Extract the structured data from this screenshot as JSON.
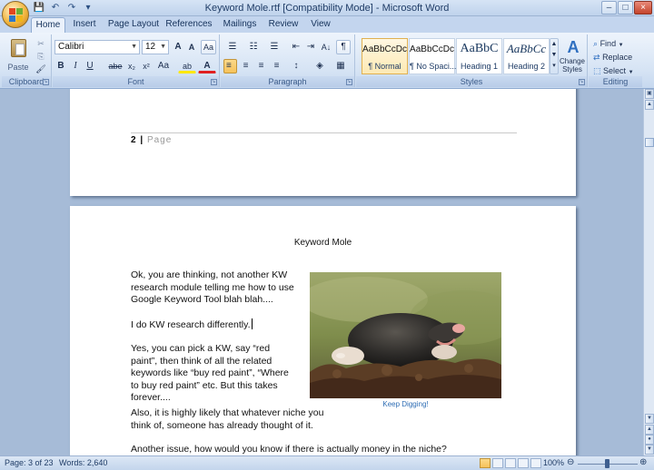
{
  "window": {
    "title": "Keyword Mole.rtf [Compatibility Mode] - Microsoft Word",
    "minimize": "–",
    "maximize": "□",
    "close": "×"
  },
  "quick_access": {
    "save": "💾",
    "undo": "↶",
    "redo": "↷",
    "customize": "▾"
  },
  "tabs": [
    "Home",
    "Insert",
    "Page Layout",
    "References",
    "Mailings",
    "Review",
    "View"
  ],
  "active_tab": "Home",
  "ribbon": {
    "clipboard": {
      "label": "Clipboard",
      "paste": "Paste",
      "cut": "✂",
      "copy": "⎘",
      "format_painter": "🖌"
    },
    "font": {
      "label": "Font",
      "font_name": "Calibri",
      "font_size": "12",
      "grow": "A",
      "shrink": "A",
      "clear": "Aa",
      "bold": "B",
      "italic": "I",
      "underline": "U",
      "strike": "abe",
      "subscript": "x₂",
      "superscript": "x²",
      "change_case": "Aa",
      "highlight": "ab",
      "font_color": "A"
    },
    "paragraph": {
      "label": "Paragraph",
      "bullets": "☰",
      "numbering": "☷",
      "multilevel": "☰",
      "decrease_indent": "⇤",
      "increase_indent": "⇥",
      "sort": "A↓",
      "show_marks": "¶",
      "align_left": "≡",
      "center": "≡",
      "align_right": "≡",
      "justify": "≡",
      "line_spacing": "↕",
      "shading": "◈",
      "borders": "▦"
    },
    "styles": {
      "label": "Styles",
      "items": [
        {
          "sample": "AaBbCcDc",
          "name": "¶ Normal"
        },
        {
          "sample": "AaBbCcDc",
          "name": "¶ No Spaci..."
        },
        {
          "sample": "AaBbC",
          "name": "Heading 1"
        },
        {
          "sample": "AaBbCc",
          "name": "Heading 2"
        }
      ],
      "change_styles": "Change Styles"
    },
    "editing": {
      "label": "Editing",
      "find": "Find",
      "replace": "Replace",
      "select": "Select"
    }
  },
  "document": {
    "footer_page_number": "2",
    "footer_separator": "|",
    "footer_label": "Page",
    "title": "Keyword Mole",
    "paragraphs": [
      "Ok, you are thinking, not another KW research module telling me how to use Google Keyword Tool blah blah....",
      "I do KW research differently.",
      "Yes, you can pick a KW, say “red paint”, then think of all the related keywords like “buy red paint”, “Where to buy red paint” etc. But this takes forever....",
      "Also, it is highly likely that whatever niche you think of, someone has already thought of it.",
      "Another issue, how would you know if there is actually money in the niche?"
    ],
    "image_caption": "Keep Digging!"
  },
  "status_bar": {
    "page": "Page: 3 of 23",
    "words": "Words: 2,640",
    "zoom": "100%",
    "zoom_out": "⊖",
    "zoom_in": "⊕"
  }
}
